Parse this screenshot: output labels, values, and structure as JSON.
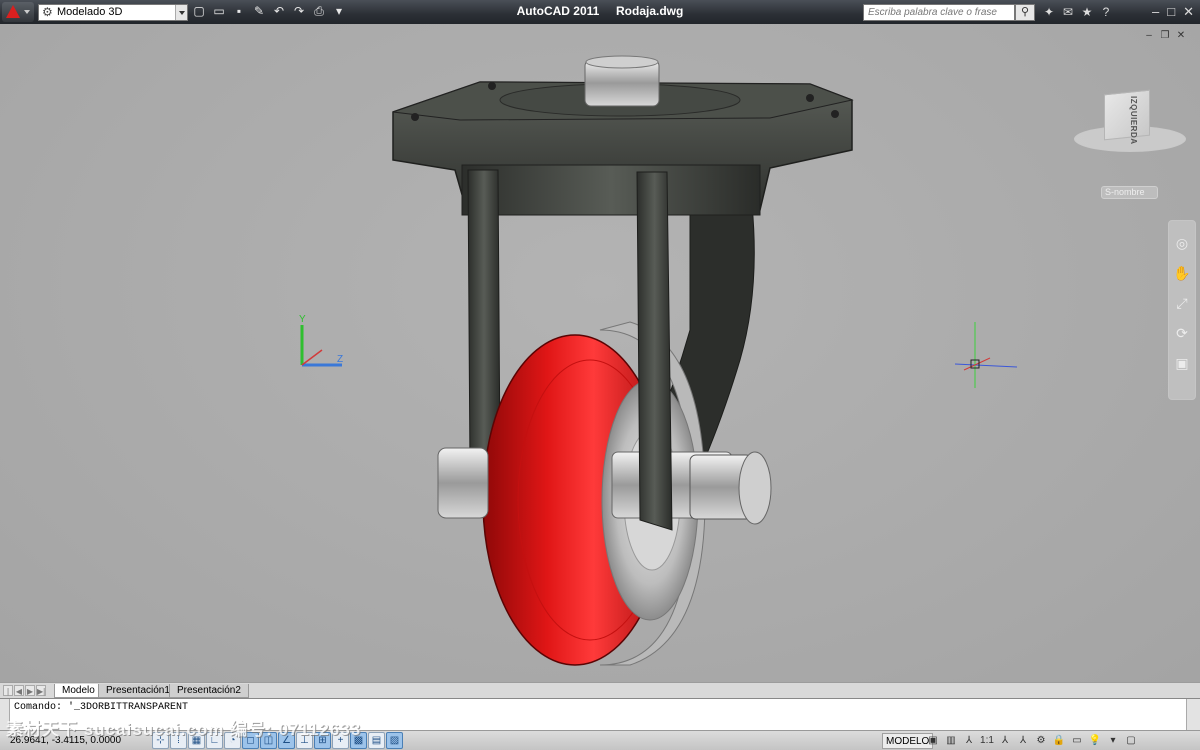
{
  "titlebar": {
    "workspace": "Modelado 3D",
    "title": "AutoCAD 2011",
    "filename": "Rodaja.dwg",
    "search_placeholder": "Escriba palabra clave o frase"
  },
  "viewport": {
    "viewcube_face": "IZQUIERDA",
    "wcs_label": "S-nombre"
  },
  "layout_tabs": [
    {
      "label": "Modelo",
      "active": true
    },
    {
      "label": "Presentación1",
      "active": false
    },
    {
      "label": "Presentación2",
      "active": false
    }
  ],
  "command": {
    "label": "Comando:",
    "text": "'_3DORBITTRANSPARENT"
  },
  "status": {
    "coords": "26.9641, -3.4115, 0.0000",
    "space": "MODELO",
    "scale": "1:1"
  },
  "watermark": "素材天下 sucaisucai.com  编号: 07112633",
  "colors": {
    "viewport_bg": "#aaaaaa",
    "wheel_tread": "#d41414",
    "frame": "#3c3f3b",
    "titlebar": "#2b2f35",
    "accent": "#9cc3ea"
  }
}
